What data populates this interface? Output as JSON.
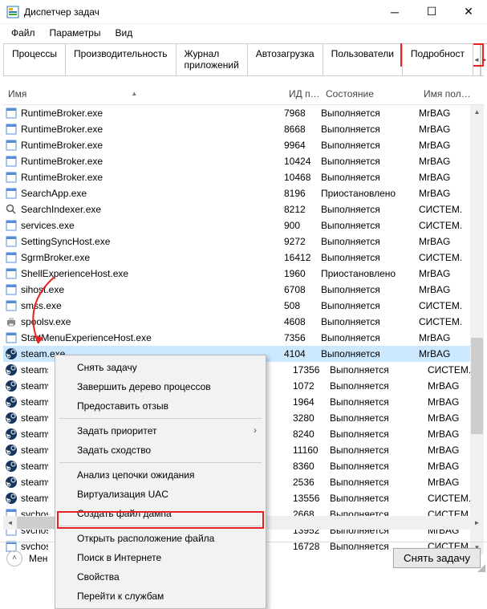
{
  "window": {
    "title": "Диспетчер задач"
  },
  "menu": {
    "file": "Файл",
    "options": "Параметры",
    "view": "Вид"
  },
  "tabs": {
    "items": [
      "Процессы",
      "Производительность",
      "Журнал приложений",
      "Автозагрузка",
      "Пользователи",
      "Подробност"
    ],
    "nav_left": "◄",
    "nav_right": "►"
  },
  "columns": {
    "name": "Имя",
    "pid": "ИД п…",
    "state": "Состояние",
    "user": "Имя пол…"
  },
  "users": {
    "mrbag": "MrBAG",
    "system": "СИСТЕМ."
  },
  "states": {
    "run": "Выполняется",
    "suspend": "Приостановлено"
  },
  "processes": [
    {
      "name": "RuntimeBroker.exe",
      "pid": "7968",
      "state": "run",
      "user": "mrbag",
      "icon": "app"
    },
    {
      "name": "RuntimeBroker.exe",
      "pid": "8668",
      "state": "run",
      "user": "mrbag",
      "icon": "app"
    },
    {
      "name": "RuntimeBroker.exe",
      "pid": "9964",
      "state": "run",
      "user": "mrbag",
      "icon": "app"
    },
    {
      "name": "RuntimeBroker.exe",
      "pid": "10424",
      "state": "run",
      "user": "mrbag",
      "icon": "app"
    },
    {
      "name": "RuntimeBroker.exe",
      "pid": "10468",
      "state": "run",
      "user": "mrbag",
      "icon": "app"
    },
    {
      "name": "SearchApp.exe",
      "pid": "8196",
      "state": "suspend",
      "user": "mrbag",
      "icon": "app"
    },
    {
      "name": "SearchIndexer.exe",
      "pid": "8212",
      "state": "run",
      "user": "system",
      "icon": "search"
    },
    {
      "name": "services.exe",
      "pid": "900",
      "state": "run",
      "user": "system",
      "icon": "app"
    },
    {
      "name": "SettingSyncHost.exe",
      "pid": "9272",
      "state": "run",
      "user": "mrbag",
      "icon": "app"
    },
    {
      "name": "SgrmBroker.exe",
      "pid": "16412",
      "state": "run",
      "user": "system",
      "icon": "app"
    },
    {
      "name": "ShellExperienceHost.exe",
      "pid": "1960",
      "state": "suspend",
      "user": "mrbag",
      "icon": "app"
    },
    {
      "name": "sihost.exe",
      "pid": "6708",
      "state": "run",
      "user": "mrbag",
      "icon": "app"
    },
    {
      "name": "smss.exe",
      "pid": "508",
      "state": "run",
      "user": "system",
      "icon": "app"
    },
    {
      "name": "spoolsv.exe",
      "pid": "4608",
      "state": "run",
      "user": "system",
      "icon": "print"
    },
    {
      "name": "StartMenuExperienceHost.exe",
      "pid": "7356",
      "state": "run",
      "user": "mrbag",
      "icon": "app"
    },
    {
      "name": "steam.exe",
      "pid": "4104",
      "state": "run",
      "user": "mrbag",
      "icon": "steam",
      "selected": true
    },
    {
      "name": "steams",
      "pid": "17356",
      "state": "run",
      "user": "system",
      "icon": "steam",
      "truncated": true
    },
    {
      "name": "steamv",
      "pid": "1072",
      "state": "run",
      "user": "mrbag",
      "icon": "steam",
      "truncated": true
    },
    {
      "name": "steamv",
      "pid": "1964",
      "state": "run",
      "user": "mrbag",
      "icon": "steam",
      "truncated": true
    },
    {
      "name": "steamv",
      "pid": "3280",
      "state": "run",
      "user": "mrbag",
      "icon": "steam",
      "truncated": true
    },
    {
      "name": "steamv",
      "pid": "8240",
      "state": "run",
      "user": "mrbag",
      "icon": "steam",
      "truncated": true
    },
    {
      "name": "steamv",
      "pid": "11160",
      "state": "run",
      "user": "mrbag",
      "icon": "steam",
      "truncated": true
    },
    {
      "name": "steamv",
      "pid": "8360",
      "state": "run",
      "user": "mrbag",
      "icon": "steam",
      "truncated": true
    },
    {
      "name": "steamv",
      "pid": "2536",
      "state": "run",
      "user": "mrbag",
      "icon": "steam",
      "truncated": true
    },
    {
      "name": "steamv",
      "pid": "13556",
      "state": "run",
      "user": "system",
      "icon": "steam",
      "truncated": true
    },
    {
      "name": "svchos",
      "pid": "2668",
      "state": "run",
      "user": "system",
      "icon": "app",
      "truncated": true
    },
    {
      "name": "svchos",
      "pid": "13952",
      "state": "run",
      "user": "mrbag",
      "icon": "app",
      "truncated": true
    },
    {
      "name": "svchos",
      "pid": "16728",
      "state": "run",
      "user": "system",
      "icon": "app",
      "truncated": true
    }
  ],
  "context_menu": {
    "end_task": "Снять задачу",
    "end_tree": "Завершить дерево процессов",
    "feedback": "Предоставить отзыв",
    "priority": "Задать приоритет",
    "affinity": "Задать сходство",
    "wait_chain": "Анализ цепочки ожидания",
    "uac": "Виртуализация UAC",
    "dump": "Создать файл дампа",
    "open_location": "Открыть расположение файла",
    "search_online": "Поиск в Интернете",
    "properties": "Свойства",
    "goto_services": "Перейти к службам"
  },
  "statusbar": {
    "less": "Мен",
    "end_task": "Снять задачу"
  },
  "colors": {
    "selection": "#cce8ff",
    "highlight": "#e62222"
  }
}
